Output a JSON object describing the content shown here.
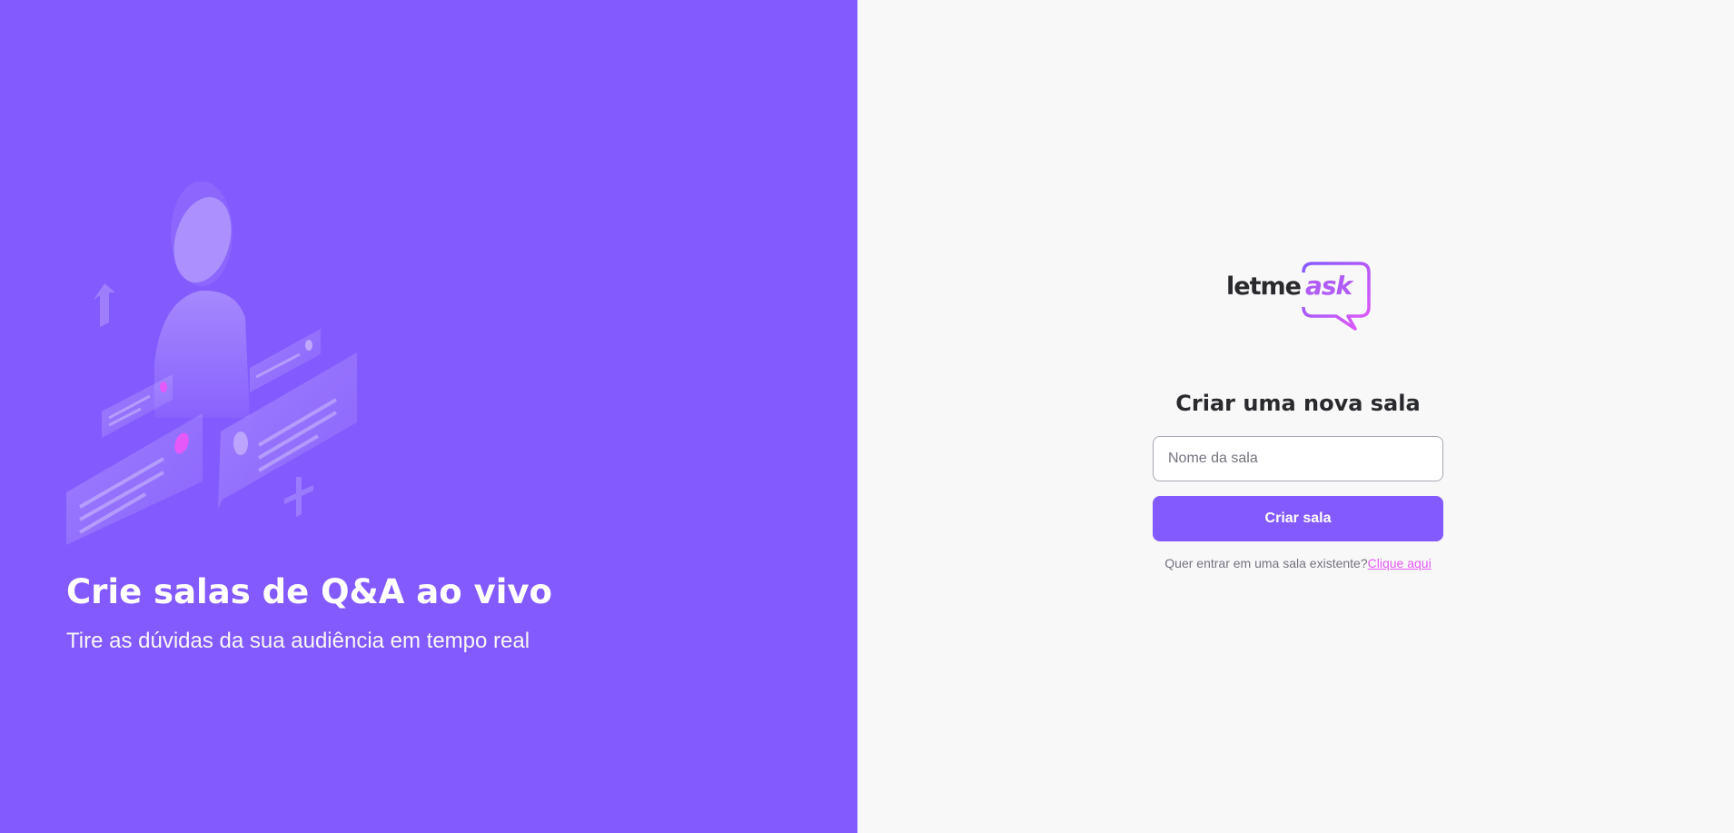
{
  "aside": {
    "illustration_icon": "qa-illustration",
    "title": "Crie salas de Q&A ao vivo",
    "subtitle": "Tire as dúvidas da sua audiência em tempo real"
  },
  "main": {
    "logo": {
      "letme": "letme",
      "ask": "ask"
    },
    "form_title": "Criar uma nova sala",
    "room_input": {
      "placeholder": "Nome da sala",
      "value": ""
    },
    "create_button": "Criar sala",
    "join_prompt": "Quer entrar em uma sala existente?",
    "join_link": "Clique aqui"
  },
  "colors": {
    "brand_purple": "#835afd",
    "background": "#f8f8f8",
    "link_pink": "#e559f9",
    "text_dark": "#29292e"
  }
}
